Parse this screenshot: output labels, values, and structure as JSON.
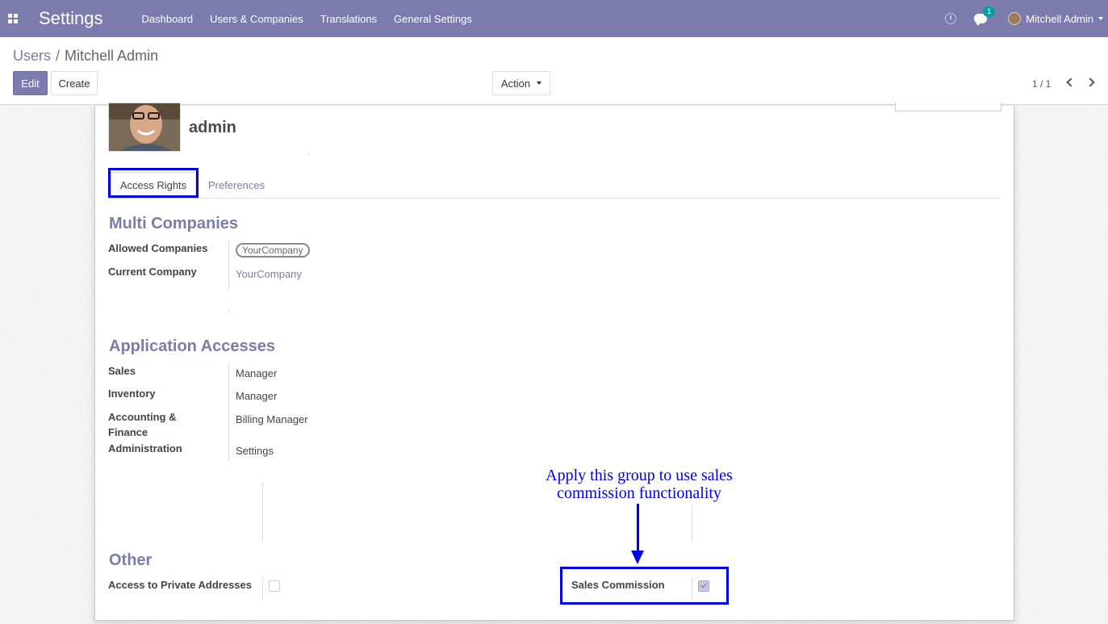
{
  "navbar": {
    "brand": "Settings",
    "menu": [
      "Dashboard",
      "Users & Companies",
      "Translations",
      "General Settings"
    ],
    "messages_badge": "1",
    "user_name": "Mitchell Admin"
  },
  "breadcrumb": {
    "parent": "Users",
    "separator": "/",
    "current": "Mitchell Admin"
  },
  "buttons": {
    "edit": "Edit",
    "create": "Create",
    "action": "Action"
  },
  "pager": {
    "value": "1 / 1"
  },
  "form": {
    "login": "admin",
    "tabs": {
      "access_rights": "Access Rights",
      "preferences": "Preferences"
    },
    "multi_companies": {
      "title": "Multi Companies",
      "allowed_label": "Allowed Companies",
      "allowed_value": "YourCompany",
      "current_label": "Current Company",
      "current_value": "YourCompany"
    },
    "application_accesses": {
      "title": "Application Accesses",
      "sales_label": "Sales",
      "sales_value": "Manager",
      "inventory_label": "Inventory",
      "inventory_value": "Manager",
      "accounting_label_1": "Accounting &",
      "accounting_label_2": "Finance",
      "accounting_value": "Billing Manager",
      "administration_label": "Administration",
      "administration_value": "Settings"
    },
    "other": {
      "title": "Other",
      "private_addresses_label": "Access to Private Addresses",
      "private_addresses_checked": false,
      "sales_commission_label": "Sales Commission",
      "sales_commission_checked": true
    }
  },
  "annotation": {
    "line1": "Apply this group to use sales",
    "line2": "commission functionality"
  },
  "colors": {
    "brand": "#7c7bad",
    "highlight": "#0000e6",
    "badge": "#00a09d"
  }
}
